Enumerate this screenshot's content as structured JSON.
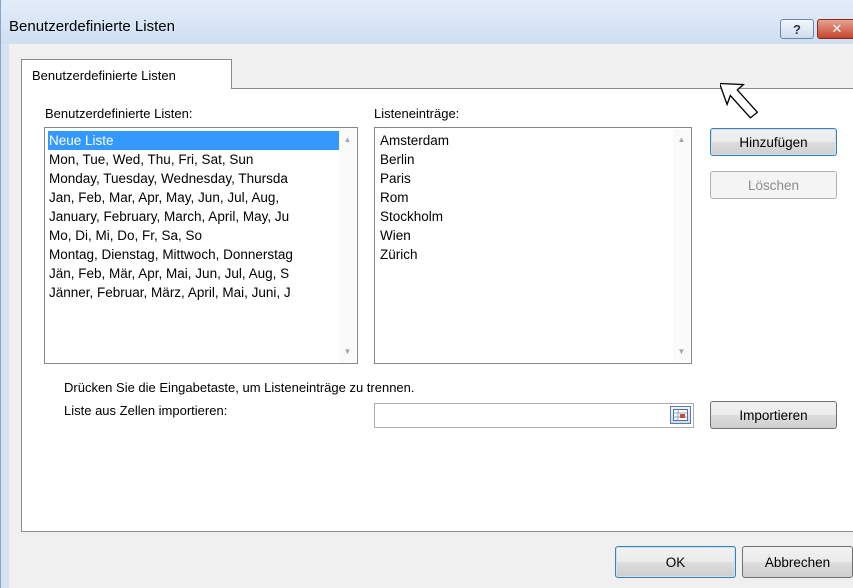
{
  "window": {
    "title": "Benutzerdefinierte Listen",
    "help_glyph": "?",
    "close_glyph": "✕"
  },
  "tab": {
    "label": "Benutzerdefinierte Listen"
  },
  "custom_lists": {
    "label": "Benutzerdefinierte Listen:",
    "items": [
      "Neue Liste",
      "Mon, Tue, Wed, Thu, Fri, Sat, Sun",
      "Monday, Tuesday, Wednesday, Thursda",
      "Jan, Feb, Mar, Apr, May, Jun, Jul, Aug,",
      "January, February, March, April, May, Ju",
      "Mo, Di, Mi, Do, Fr, Sa, So",
      "Montag, Dienstag, Mittwoch, Donnerstag",
      "Jän, Feb, Mär, Apr, Mai, Jun, Jul, Aug, S",
      "Jänner, Februar, März, April, Mai, Juni, J"
    ],
    "selected_index": 0
  },
  "list_entries": {
    "label": "Listeneinträge:",
    "items": [
      "Amsterdam",
      "Berlin",
      "Paris",
      "Rom",
      "Stockholm",
      "Wien",
      "Zürich"
    ]
  },
  "buttons": {
    "add": "Hinzufügen",
    "delete": "Löschen",
    "import": "Importieren",
    "ok": "OK",
    "cancel": "Abbrechen"
  },
  "hint_text": "Drücken Sie die Eingabetaste, um Listeneinträge zu trennen.",
  "import_label": "Liste aus Zellen importieren:",
  "import_value": "",
  "icons": {
    "scroll_up": "▲",
    "scroll_down": "▼"
  },
  "colors": {
    "selection": "#3399ff",
    "title_bar": "#d6e3f3",
    "close_button": "#c4452e"
  }
}
